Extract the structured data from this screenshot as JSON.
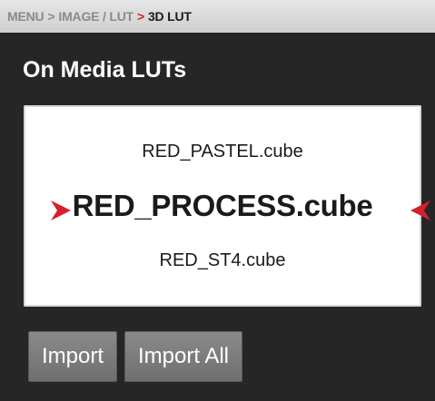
{
  "breadcrumb": {
    "items": [
      "MENU",
      "IMAGE / LUT",
      "3D LUT"
    ],
    "separator": ">",
    "separator_color": "#8a8a8a",
    "active_separator_color": "#d3202a"
  },
  "section": {
    "title": "On Media LUTs"
  },
  "lut_list": {
    "previous": "RED_PASTEL.cube",
    "selected": "RED_PROCESS.cube",
    "next": "RED_ST4.cube",
    "arrow_color": "#d3202a",
    "left_arrow_icon": "triangle-right-icon",
    "right_arrow_icon": "triangle-left-icon"
  },
  "buttons": {
    "import_label": "Import",
    "import_all_label": "Import All"
  },
  "colors": {
    "background": "#262626",
    "accent": "#d3202a"
  }
}
